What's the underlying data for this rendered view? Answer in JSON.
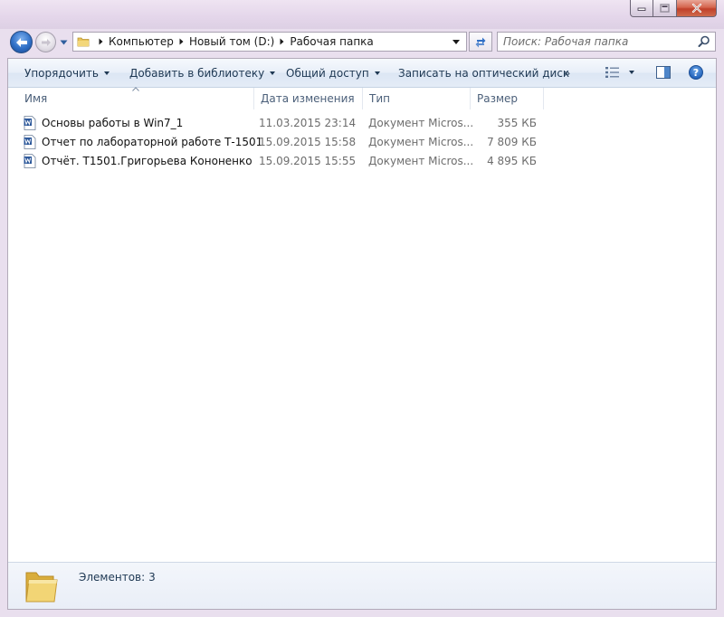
{
  "window": {
    "buttons": {
      "minimize": "minimize-icon",
      "maximize": "maximize-icon",
      "close": "close-icon"
    }
  },
  "nav": {
    "back_icon": "back-arrow-icon",
    "forward_icon": "forward-arrow-icon",
    "breadcrumb": [
      "Компьютер",
      "Новый том (D:)",
      "Рабочая папка"
    ],
    "search_placeholder": "Поиск: Рабочая папка"
  },
  "toolbar": {
    "organize": "Упорядочить",
    "add_to_library": "Добавить в библиотеку",
    "share": "Общий доступ",
    "burn": "Записать на оптический диск",
    "more": "»"
  },
  "columns": {
    "name": "Имя",
    "date": "Дата изменения",
    "type": "Тип",
    "size": "Размер"
  },
  "files": [
    {
      "name": "Основы работы в  Win7_1",
      "date": "11.03.2015 23:14",
      "type": "Документ Micros...",
      "size": "355 КБ",
      "icon": "word-document-icon"
    },
    {
      "name": "Отчет по лабораторной работе Т-1501",
      "date": "15.09.2015 15:58",
      "type": "Документ Micros...",
      "size": "7 809 КБ",
      "icon": "word-document-icon"
    },
    {
      "name": "Отчёт. Т1501.Григорьева Кононенко",
      "date": "15.09.2015 15:55",
      "type": "Документ Micros...",
      "size": "4 895 КБ",
      "icon": "word-document-icon"
    }
  ],
  "details": {
    "label": "Элементов:",
    "count": "3"
  },
  "colors": {
    "accent": "#2f6fc6",
    "toolbar_text": "#1e3853",
    "close_button": "#c7452f"
  }
}
